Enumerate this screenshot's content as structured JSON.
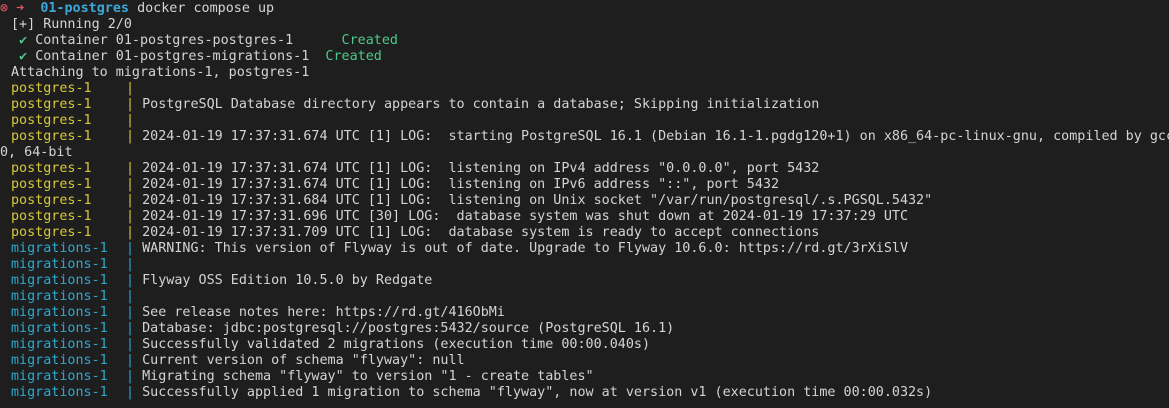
{
  "prompt": {
    "status_glyph": "⊗",
    "arrow_glyph": "➜",
    "dir": "01-postgres",
    "command": "docker compose up"
  },
  "status": {
    "running": "[+] Running 2/0",
    "check_glyph": "✔",
    "containers": [
      {
        "name": "Container 01-postgres-postgres-1  ",
        "state": "Created"
      },
      {
        "name": "Container 01-postgres-migrations-1",
        "state": "Created"
      }
    ],
    "attaching": "Attaching to migrations-1, postgres-1"
  },
  "pipe": "|",
  "prefixes": {
    "postgres": "postgres-1",
    "migrations": "migrations-1"
  },
  "log": [
    {
      "src": "postgres",
      "msg": ""
    },
    {
      "src": "postgres",
      "msg": "PostgreSQL Database directory appears to contain a database; Skipping initialization"
    },
    {
      "src": "postgres",
      "msg": ""
    },
    {
      "src": "postgres",
      "msg": "2024-01-19 17:37:31.674 UTC [1] LOG:  starting PostgreSQL 16.1 (Debian 16.1-1.pgdg120+1) on x86_64-pc-linux-gnu, compiled by gcc",
      "wrap": "0, 64-bit"
    },
    {
      "src": "postgres",
      "msg": "2024-01-19 17:37:31.674 UTC [1] LOG:  listening on IPv4 address \"0.0.0.0\", port 5432"
    },
    {
      "src": "postgres",
      "msg": "2024-01-19 17:37:31.674 UTC [1] LOG:  listening on IPv6 address \"::\", port 5432"
    },
    {
      "src": "postgres",
      "msg": "2024-01-19 17:37:31.684 UTC [1] LOG:  listening on Unix socket \"/var/run/postgresql/.s.PGSQL.5432\""
    },
    {
      "src": "postgres",
      "msg": "2024-01-19 17:37:31.696 UTC [30] LOG:  database system was shut down at 2024-01-19 17:37:29 UTC"
    },
    {
      "src": "postgres",
      "msg": "2024-01-19 17:37:31.709 UTC [1] LOG:  database system is ready to accept connections"
    },
    {
      "src": "migrations",
      "msg": "WARNING: This version of Flyway is out of date. Upgrade to Flyway 10.6.0: https://rd.gt/3rXiSlV"
    },
    {
      "src": "migrations",
      "msg": ""
    },
    {
      "src": "migrations",
      "msg": "Flyway OSS Edition 10.5.0 by Redgate"
    },
    {
      "src": "migrations",
      "msg": ""
    },
    {
      "src": "migrations",
      "msg": "See release notes here: https://rd.gt/416ObMi"
    },
    {
      "src": "migrations",
      "msg": "Database: jdbc:postgresql://postgres:5432/source (PostgreSQL 16.1)"
    },
    {
      "src": "migrations",
      "msg": "Successfully validated 2 migrations (execution time 00:00.040s)"
    },
    {
      "src": "migrations",
      "msg": "Current version of schema \"flyway\": null"
    },
    {
      "src": "migrations",
      "msg": "Migrating schema \"flyway\" to version \"1 - create tables\""
    },
    {
      "src": "migrations",
      "msg": "Successfully applied 1 migration to schema \"flyway\", now at version v1 (execution time 00:00.032s)"
    }
  ],
  "colors": {
    "background": "#1e1e1e",
    "text": "#d4d4d4",
    "error": "#e05561",
    "dir": "#3ca8d8",
    "success": "#4ec88a",
    "postgres_prefix": "#d6c73c",
    "migrations_prefix": "#2fa7cf"
  }
}
